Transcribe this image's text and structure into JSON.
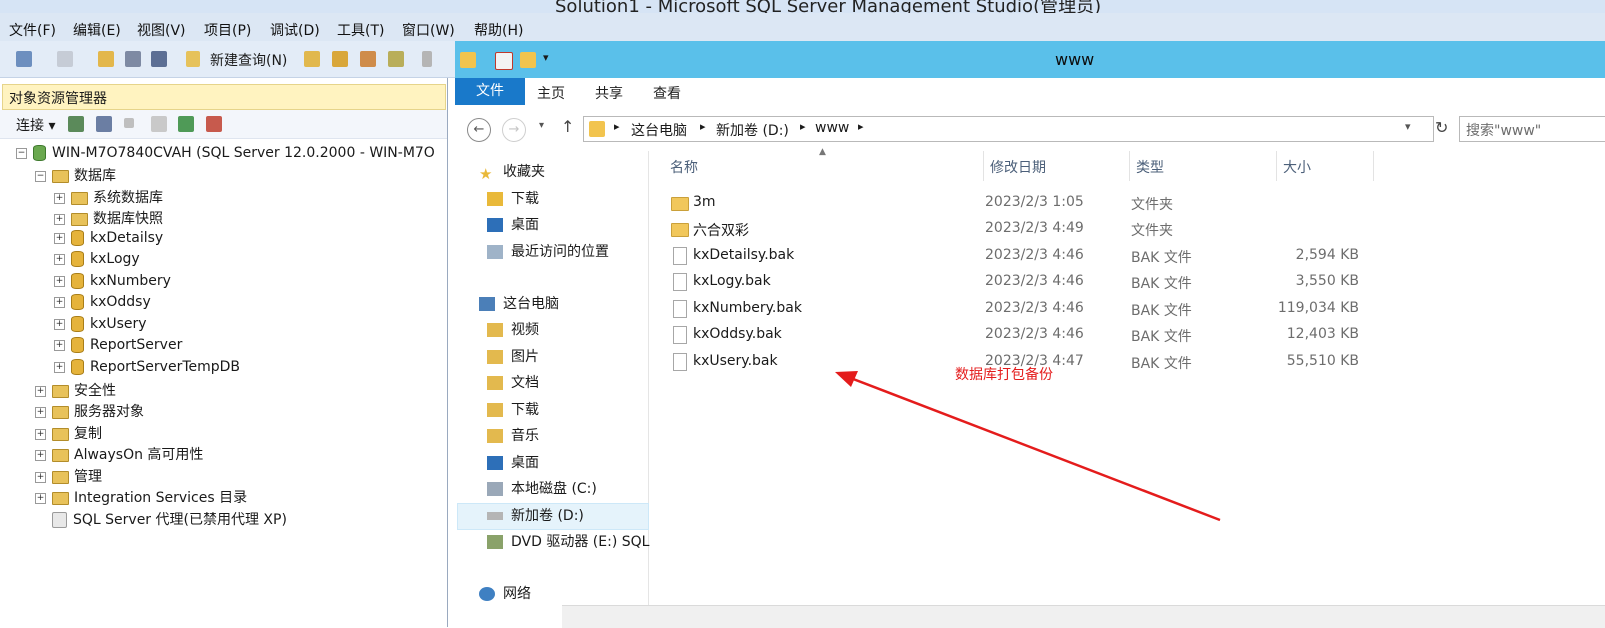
{
  "ssms": {
    "title": "Solution1 - Microsoft SQL Server Management Studio(管理员)",
    "menu": [
      "文件(F)",
      "编辑(E)",
      "视图(V)",
      "项目(P)",
      "调试(D)",
      "工具(T)",
      "窗口(W)",
      "帮助(H)"
    ],
    "toolbar": {
      "new_query": "新建查询(N)"
    }
  },
  "object_explorer": {
    "title": "对象资源管理器",
    "connect_label": "连接 ▾",
    "server": "WIN-M7O7840CVAH (SQL Server 12.0.2000 - WIN-M7O",
    "databases_label": "数据库",
    "db_children": [
      "系统数据库",
      "数据库快照",
      "kxDetailsy",
      "kxLogy",
      "kxNumbery",
      "kxOddsy",
      "kxUsery",
      "ReportServer",
      "ReportServerTempDB"
    ],
    "server_children": [
      "安全性",
      "服务器对象",
      "复制",
      "AlwaysOn 高可用性",
      "管理",
      "Integration Services 目录"
    ],
    "agent": "SQL Server 代理(已禁用代理 XP)"
  },
  "explorer": {
    "title": "www",
    "ribbon": {
      "file": "文件",
      "tabs": [
        "主页",
        "共享",
        "查看"
      ]
    },
    "address": [
      "这台电脑",
      "新加卷 (D:)",
      "www"
    ],
    "search_placeholder": "搜索\"www\"",
    "nav": {
      "favorites": "收藏夹",
      "fav_items": [
        "下载",
        "桌面",
        "最近访问的位置"
      ],
      "this_pc": "这台电脑",
      "pc_items": [
        "视频",
        "图片",
        "文档",
        "下载",
        "音乐",
        "桌面",
        "本地磁盘 (C:)",
        "新加卷 (D:)",
        "DVD 驱动器 (E:) SQL"
      ],
      "network": "网络"
    },
    "columns": [
      "名称",
      "修改日期",
      "类型",
      "大小"
    ],
    "files": [
      {
        "name": "3m",
        "date": "2023/2/3 1:05",
        "type": "文件夹",
        "size": "",
        "kind": "folder"
      },
      {
        "name": "六合双彩",
        "date": "2023/2/3 4:49",
        "type": "文件夹",
        "size": "",
        "kind": "folder"
      },
      {
        "name": "kxDetailsy.bak",
        "date": "2023/2/3 4:46",
        "type": "BAK 文件",
        "size": "2,594 KB",
        "kind": "file"
      },
      {
        "name": "kxLogy.bak",
        "date": "2023/2/3 4:46",
        "type": "BAK 文件",
        "size": "3,550 KB",
        "kind": "file"
      },
      {
        "name": "kxNumbery.bak",
        "date": "2023/2/3 4:46",
        "type": "BAK 文件",
        "size": "119,034 KB",
        "kind": "file"
      },
      {
        "name": "kxOddsy.bak",
        "date": "2023/2/3 4:46",
        "type": "BAK 文件",
        "size": "12,403 KB",
        "kind": "file"
      },
      {
        "name": "kxUsery.bak",
        "date": "2023/2/3 4:47",
        "type": "BAK 文件",
        "size": "55,510 KB",
        "kind": "file"
      }
    ],
    "annotation": "数据库打包备份"
  },
  "colors": {
    "title_bar": "#5ac0ea",
    "file_tab": "#1979ca",
    "annotation": "#e41c1c",
    "oe_header": "#fff3c0"
  }
}
